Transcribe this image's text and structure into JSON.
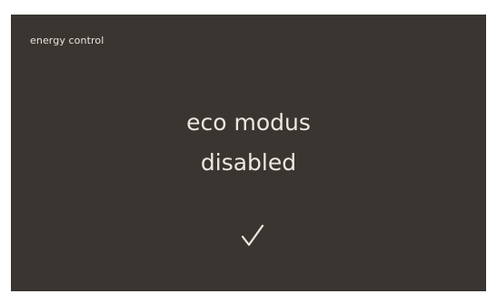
{
  "screen": {
    "title": "energy control",
    "message": {
      "line1": "eco modus",
      "line2": "disabled"
    },
    "confirm_icon": "checkmark-icon",
    "colors": {
      "background": "#3a3530",
      "text": "#ece8e2"
    }
  }
}
